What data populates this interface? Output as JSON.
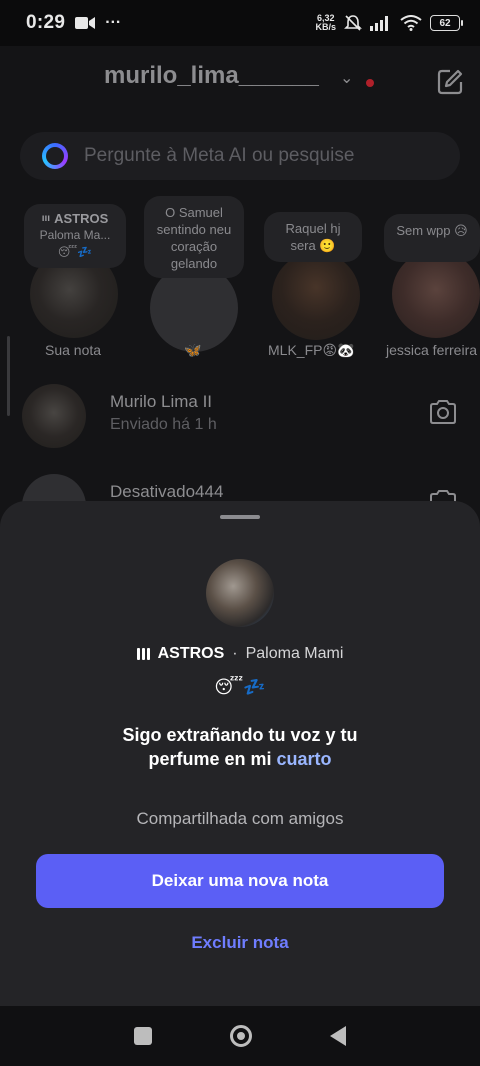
{
  "status_bar": {
    "time": "0:29",
    "more": "···",
    "net_speed_value": "6,32",
    "net_speed_unit": "KB/s",
    "battery": "62"
  },
  "header": {
    "username": "murilo_lima______",
    "chevron": "⌄"
  },
  "search": {
    "placeholder": "Pergunte à Meta AI ou pesquise"
  },
  "notes": [
    {
      "bubble_title": "ASTROS",
      "bubble_line1": "Paloma Ma...",
      "bubble_line2": "😴💤",
      "label": "Sua nota"
    },
    {
      "bubble_text": "O Samuel sentindo neu coração gelando",
      "label": "🦋"
    },
    {
      "bubble_text": "Raquel hj sera 🙂",
      "label": "MLK_FP😡🐼"
    },
    {
      "bubble_text": "Sem wpp 😥",
      "label": "jessica ferreira"
    }
  ],
  "chats": [
    {
      "name": "Murilo Lima II",
      "status": "Enviado há 1 h"
    },
    {
      "name": "Desativado444",
      "status": ""
    }
  ],
  "sheet": {
    "song_title": "ASTROS",
    "separator": "·",
    "artist": "Paloma Mami",
    "emojis": "😴💤",
    "note_text_part1": "Sigo extrañando tu voz y tu perfume en mi ",
    "note_text_highlight": "cuarto",
    "shared_label": "Compartilhada com amigos",
    "primary_button": "Deixar uma nova nota",
    "delete_button": "Excluir nota"
  },
  "colors": {
    "accent_button": "#5b5ff5",
    "link": "#6f7dff",
    "sheet_bg": "#242427",
    "unread_dot": "#b0202a"
  }
}
